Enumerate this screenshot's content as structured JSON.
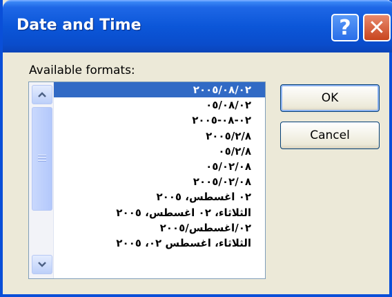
{
  "window": {
    "title": "Date and Time",
    "help_glyph": "?",
    "close_glyph": "✕"
  },
  "label": "Available formats:",
  "formats": {
    "selected_index": 0,
    "items": [
      "٢٠٠٥/٠٨/٠٢",
      "٠٥/٠٨/٠٢",
      "٠٢-٠٨-٢٠٠٥",
      "٢٠٠٥/٢/٨",
      "٠٥/٢/٨",
      "٠٥/٠٢/٠٨",
      "٢٠٠٥/٠٢/٠٨",
      "٠٢ اغسطس، ٢٠٠٥",
      "الثلاثاء، ٠٢ اغسطس، ٢٠٠٥",
      "٠٢/اغسطس/٢٠٠٥",
      "الثلاثاء، اغسطس ٠٢، ٢٠٠٥"
    ]
  },
  "buttons": {
    "ok": "OK",
    "cancel": "Cancel"
  },
  "colors": {
    "titlebar": "#0a4fd8",
    "selection": "#316ac5",
    "dialog_bg": "#ece9d8",
    "close_button": "#c8451f"
  }
}
